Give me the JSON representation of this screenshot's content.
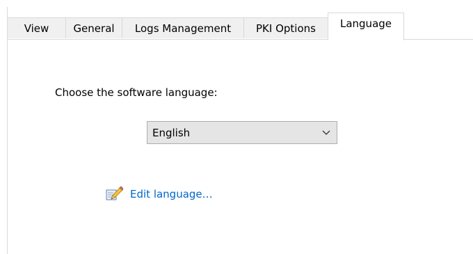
{
  "tabs": [
    {
      "label": "View",
      "selected": false
    },
    {
      "label": "General",
      "selected": false
    },
    {
      "label": "Logs Management",
      "selected": false
    },
    {
      "label": "PKI Options",
      "selected": false
    },
    {
      "label": "Language",
      "selected": true
    }
  ],
  "language": {
    "prompt": "Choose the software language:",
    "selected_value": "English",
    "edit_link_label": "Edit language…",
    "edit_icon": "pencil-edit-icon",
    "link_color": "#0066cc"
  }
}
